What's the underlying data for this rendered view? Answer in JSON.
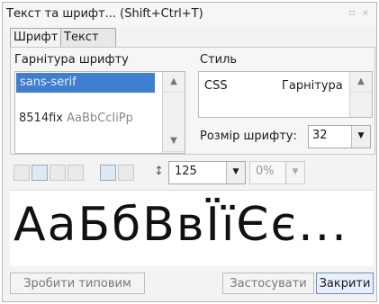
{
  "window": {
    "title": "Текст та шрифт... (Shift+Ctrl+T)"
  },
  "tabs": [
    {
      "label": "Шрифт",
      "underline": "Ш"
    },
    {
      "label": "Текст",
      "underline": "Т"
    }
  ],
  "font_family": {
    "label": "Гарнітура шрифту",
    "items": [
      {
        "name": "sans-serif",
        "selected": true
      },
      {
        "name": "8514fix",
        "sample": "AaBbCcIiPp"
      }
    ]
  },
  "style": {
    "label": "Стиль",
    "row": {
      "left": "CSS",
      "right": "Гарнітура"
    }
  },
  "size": {
    "label": "Розмір шрифту:",
    "value": "32"
  },
  "toolbar": {
    "zoom_label": "125%",
    "zoom_display": "125",
    "percent_label": "0%"
  },
  "preview": {
    "text": "АаБбВвЇїЄє..."
  },
  "buttons": {
    "default": "Зробити типовим",
    "apply": "Застосувати",
    "close": "Закрити"
  },
  "colors": {
    "accent": "#3f7fcf",
    "window_bg": "#f3f3f3",
    "preview_bg": "#ffffff"
  }
}
